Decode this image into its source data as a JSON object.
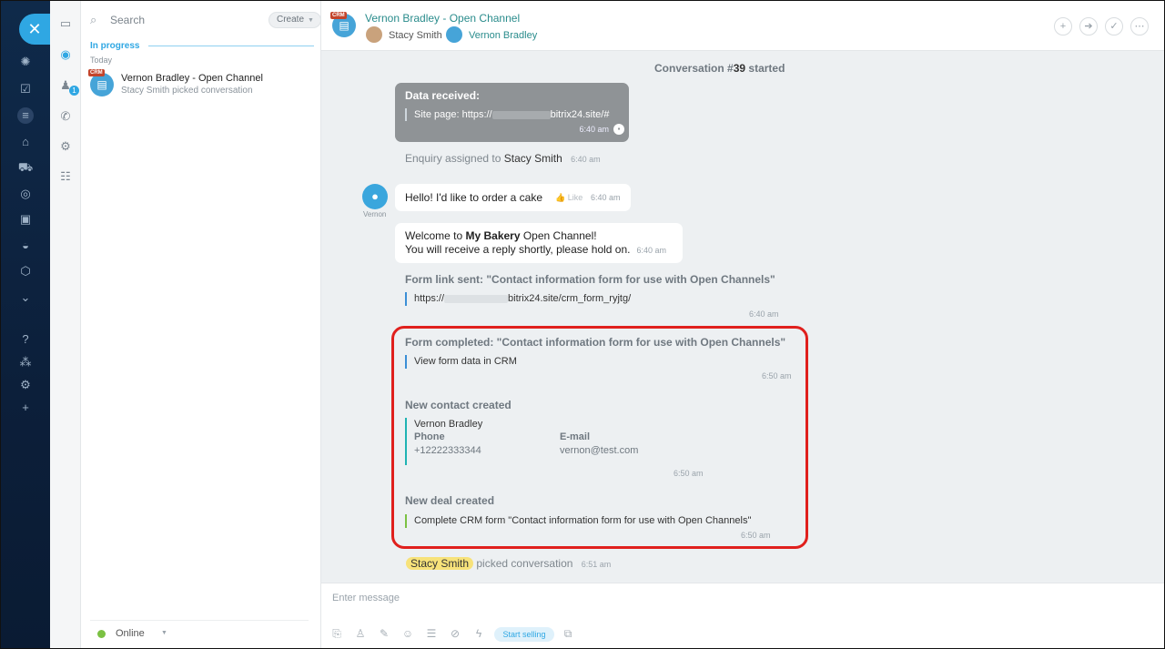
{
  "recent": {
    "search_placeholder": "Search",
    "create_label": "Create",
    "section_title": "In progress",
    "day_label": "Today",
    "chat": {
      "crm_tag": "CRM",
      "title": "Vernon Bradley - Open Channel",
      "subtitle": "Stacy Smith picked conversation"
    },
    "status": "Online"
  },
  "tools": {
    "badge_count": "1"
  },
  "header": {
    "crm_tag": "CRM",
    "title": "Vernon Bradley - Open Channel",
    "operator": "Stacy Smith",
    "client": "Vernon Bradley"
  },
  "messages": {
    "conversation_prefix": "Conversation #",
    "conversation_number": "39",
    "conversation_suffix": " started",
    "data_received": {
      "title": "Data received:",
      "line_prefix": "Site page: https://",
      "line_suffix": "bitrix24.site/#",
      "time": "6:40 am"
    },
    "assigned": {
      "text": "Enquiry assigned to",
      "name": "Stacy Smith",
      "time": "6:40 am"
    },
    "client_msg": {
      "avatar_name": "Vernon",
      "text": "Hello! I'd like to order a cake",
      "like": "Like",
      "time": "6:40 am"
    },
    "welcome": {
      "line1_prefix": "Welcome to ",
      "line1_bold": "My Bakery",
      "line1_suffix": " Open Channel!",
      "line2": "You will receive a reply shortly, please hold on.",
      "time": "6:40 am"
    },
    "form_sent": {
      "title": "Form link sent: \"Contact information form for use with Open Channels\"",
      "link_prefix": "https://",
      "link_suffix": "bitrix24.site/crm_form_ryjtg/",
      "time": "6:40 am"
    },
    "form_completed": {
      "title": "Form completed: \"Contact information form for use with Open Channels\"",
      "link": "View form data in CRM",
      "time": "6:50 am"
    },
    "new_contact": {
      "title": "New contact created",
      "name": "Vernon Bradley",
      "phone_label": "Phone",
      "phone": "+12222333344",
      "email_label": "E-mail",
      "email": "vernon@test.com",
      "time": "6:50 am"
    },
    "new_deal": {
      "title": "New deal created",
      "text": "Complete CRM form \"Contact information form for use with Open Channels\"",
      "time": "6:50 am"
    },
    "picked": {
      "name": "Stacy Smith",
      "text": "picked conversation",
      "time": "6:51 am"
    }
  },
  "composer": {
    "placeholder": "Enter message",
    "start_selling": "Start selling"
  },
  "colors": {
    "accent": "#2fa7e3",
    "highlight": "#e0201d",
    "teal_bar": "#1fb3b3",
    "green_bar": "#7bc143",
    "blue_bar": "#3b8fd6"
  }
}
